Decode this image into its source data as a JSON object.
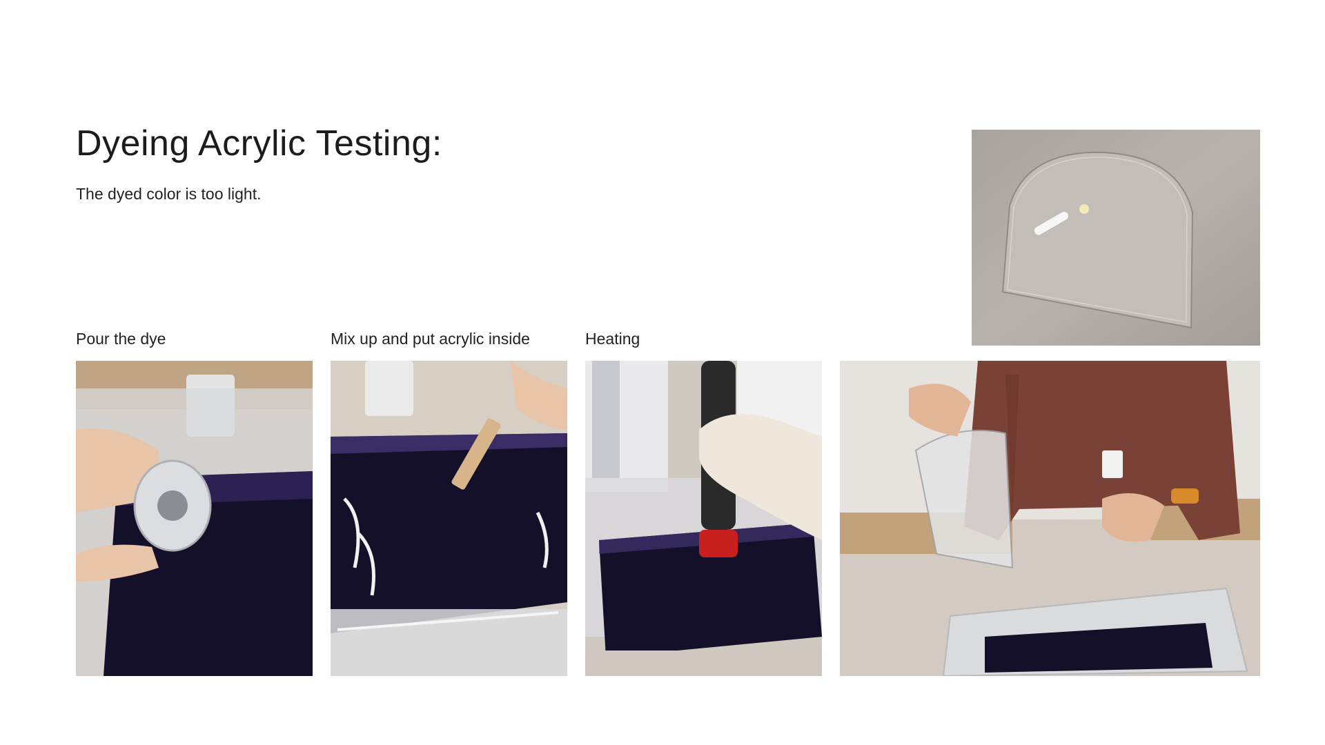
{
  "slide": {
    "title": "Dyeing Acrylic Testing:",
    "subtitle": "The dyed color is too light."
  },
  "steps": [
    {
      "caption": "Pour the dye"
    },
    {
      "caption": "Mix up and put acrylic inside"
    },
    {
      "caption": "Heating"
    }
  ],
  "colors": {
    "dye": "#14102a",
    "dye_edge": "#3d2b6e",
    "background": "#ffffff"
  }
}
